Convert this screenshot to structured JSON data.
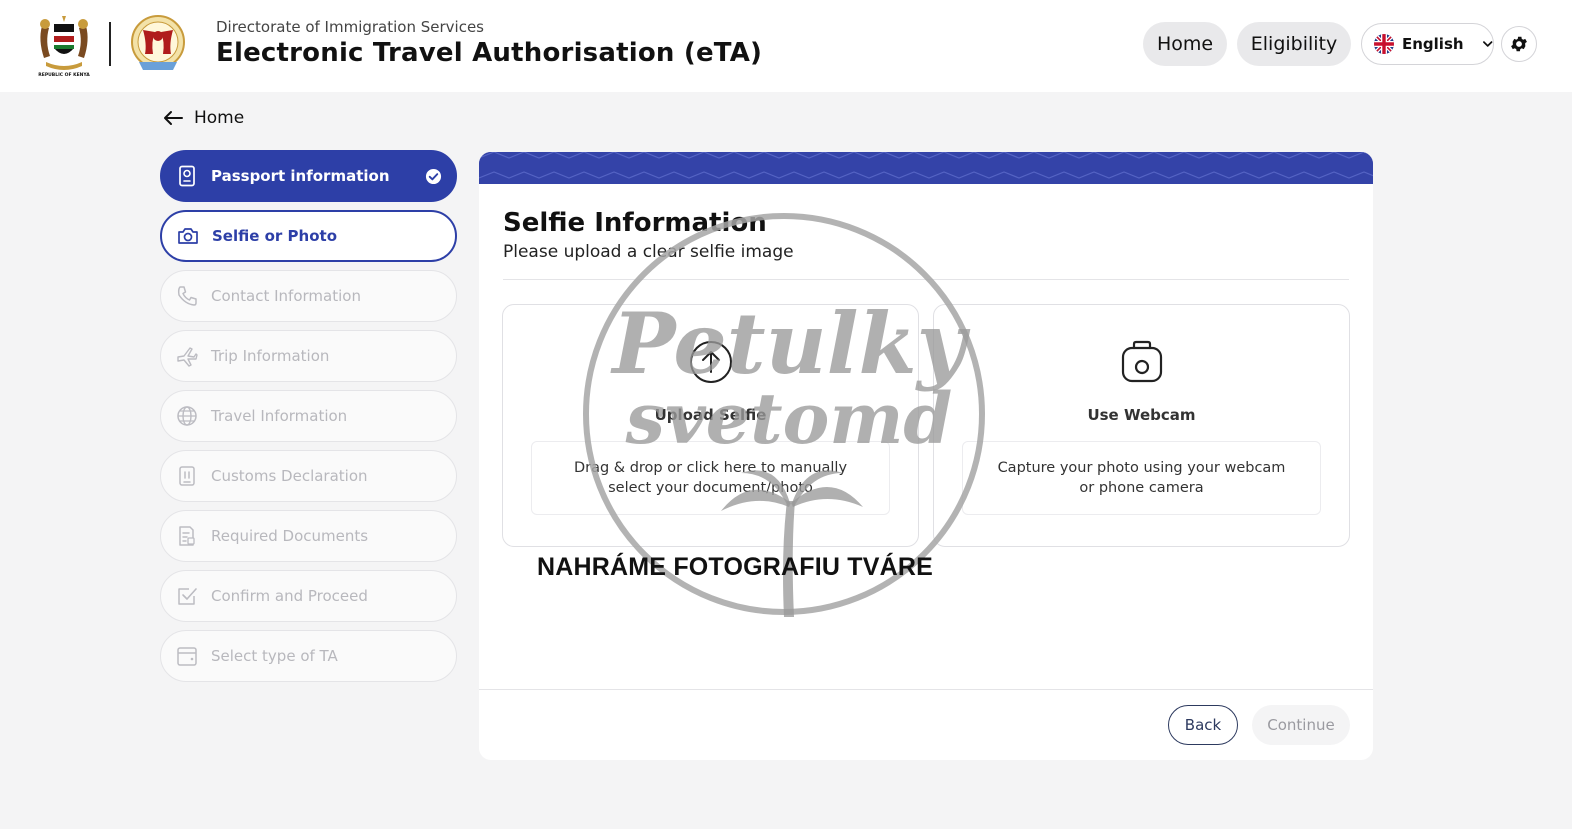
{
  "header": {
    "agency": "Directorate of Immigration Services",
    "title": "Electronic Travel Authorisation (eTA)",
    "coat_caption": "REPUBLIC OF KENYA",
    "nav": {
      "home": "Home",
      "eligibility": "Eligibility"
    },
    "language": {
      "selected": "English",
      "flag": "uk-flag-icon"
    },
    "settings_icon": "gear-icon"
  },
  "back_link": {
    "label": "Home",
    "icon": "arrow-left-icon"
  },
  "steps": [
    {
      "label": "Passport information",
      "state": "done",
      "icon": "passport-icon"
    },
    {
      "label": "Selfie or Photo",
      "state": "active",
      "icon": "camera-icon"
    },
    {
      "label": "Contact Information",
      "state": "pending",
      "icon": "phone-icon"
    },
    {
      "label": "Trip Information",
      "state": "pending",
      "icon": "plane-icon"
    },
    {
      "label": "Travel Information",
      "state": "pending",
      "icon": "globe-icon"
    },
    {
      "label": "Customs Declaration",
      "state": "pending",
      "icon": "customs-icon"
    },
    {
      "label": "Required Documents",
      "state": "pending",
      "icon": "documents-icon"
    },
    {
      "label": "Confirm and Proceed",
      "state": "pending",
      "icon": "checkbox-icon"
    },
    {
      "label": "Select type of TA",
      "state": "pending",
      "icon": "wallet-icon"
    }
  ],
  "main": {
    "title": "Selfie Information",
    "subtitle": "Please upload a clear selfie image",
    "options": {
      "upload": {
        "label": "Upload Selfie",
        "description": "Drag & drop or click here to manually select your document/photo",
        "icon": "upload-arrow-icon"
      },
      "webcam": {
        "label": "Use Webcam",
        "description": "Capture your photo using your webcam or phone camera",
        "icon": "camera-outline-icon"
      }
    },
    "back_label": "Back",
    "continue_label": "Continue"
  },
  "watermark": {
    "line1": "Petulky",
    "line2": "svetomd",
    "caption": "NAHRÁME FOTOGRAFIU TVÁRE"
  },
  "colors": {
    "primary": "#2d3fa7",
    "banner": "#3443a8",
    "background": "#f4f4f5",
    "disabled_text": "#b8b8bd"
  }
}
